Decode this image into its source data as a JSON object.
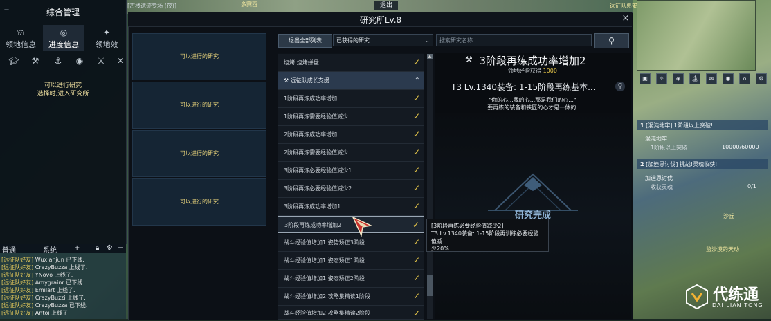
{
  "top_bar": {
    "left_text": "[古楼遗迹专场 (夜)]",
    "exit_label": "退出",
    "location_label": "多赛西",
    "right_text": "远征队惠安"
  },
  "left_panel": {
    "title": "综合管理",
    "tabs": [
      {
        "label": "领地信息",
        "icon": "territory-icon"
      },
      {
        "label": "进度信息",
        "icon": "progress-icon",
        "active": true
      },
      {
        "label": "领地效",
        "icon": "effect-icon"
      }
    ],
    "icon_row": [
      "graduation-cap-icon",
      "tools-icon",
      "anchor-icon",
      "cauldron-icon",
      "crossed-swords-icon",
      "close-icon"
    ],
    "message_line1": "可以进行研究",
    "message_line2": "选择时,进入研究所"
  },
  "chat": {
    "tabs": [
      "普通",
      "系统"
    ],
    "lines": [
      {
        "channel": "[远征队好友]",
        "text": "Wuxianjun 已下线."
      },
      {
        "channel": "[远征队好友]",
        "text": "CrazyBuzza 上线了."
      },
      {
        "channel": "[远征队好友]",
        "text": "YNovo 上线了."
      },
      {
        "channel": "[远征队好友]",
        "text": "Amygrainr 已下线."
      },
      {
        "channel": "[远征队好友]",
        "text": "Emilart 上线了."
      },
      {
        "channel": "[远征队好友]",
        "text": "CrazyBuzzi 上线了."
      },
      {
        "channel": "[远征队好友]",
        "text": "CrazyBuzza 已下线."
      },
      {
        "channel": "[远征队好友]",
        "text": "Antoi 上线了."
      }
    ]
  },
  "window": {
    "title": "研究所Lv.8",
    "close_label": "×"
  },
  "slots": [
    {
      "label": "可以进行的研究"
    },
    {
      "label": "可以进行的研究"
    },
    {
      "label": "可以进行的研究"
    },
    {
      "label": "可以进行的研究"
    }
  ],
  "toolbar": {
    "return_label": "退出全部列表",
    "filter_value": "已获得的研究",
    "search_placeholder": "搜索研究名称"
  },
  "list": {
    "rows": [
      {
        "label": "烧烤:烧烤拼盘",
        "done": true
      },
      {
        "label": "远征队成长支援",
        "header": true
      },
      {
        "label": "1阶段再炼成功率增加",
        "done": true
      },
      {
        "label": "1阶段再炼需要经验值减少",
        "done": true
      },
      {
        "label": "2阶段再炼成功率增加",
        "done": true
      },
      {
        "label": "2阶段再炼需要经验值减少",
        "done": true
      },
      {
        "label": "3阶段再炼必要经验值减少1",
        "done": true
      },
      {
        "label": "3阶段再炼必要经验值减少2",
        "done": true
      },
      {
        "label": "3阶段再炼成功率增加1",
        "done": true
      },
      {
        "label": "3阶段再炼成功率增加2",
        "done": true,
        "selected": true
      },
      {
        "label": "战斗经验值增加1:姿势矫正3阶段",
        "done": true
      },
      {
        "label": "战斗经验值增加1:姿态矫正1阶段",
        "done": true
      },
      {
        "label": "战斗经验值增加1:姿态矫正2阶段",
        "done": true
      },
      {
        "label": "战斗经验值增加2:攻略集精读1阶段",
        "done": true
      },
      {
        "label": "战斗经验值增加2:攻略集精读2阶段",
        "done": true
      }
    ]
  },
  "detail": {
    "title": "3阶段再练成功率增加2",
    "exp_label": "领地经验获得",
    "exp_value": "1000",
    "subtitle": "T3 Lv.1340装备: 1-15阶段再练基本...",
    "quote1": "\"你的心...我的心...那是我们的心...\"",
    "quote2": "要再练的装备和铁匠的心才是一体的.",
    "complete_text": "研究完成"
  },
  "tooltip": {
    "line1": "[3阶段再练必要经验值减少2]",
    "line2": "T3 Lv.1340装备: 1-15阶段再训练必要经验值减",
    "line3": "少20%"
  },
  "quests": [
    {
      "num": "1",
      "title": "[混沌地牢] 1阶段以上突破!",
      "sub": "混沌地牢",
      "detail": "1阶段以上突破",
      "progress": "10000/60000"
    },
    {
      "num": "2",
      "title": "[加迪恩讨伐] 挑战!灵魂收获!",
      "sub": "加迪恩讨伐",
      "detail": "收获灵魂",
      "progress": "0/1"
    }
  ],
  "map_labels": {
    "label1": "沙丘",
    "label2": "监沙漠的天动"
  },
  "logo": {
    "main": "代练通",
    "sub": "DAI LIAN TONG"
  }
}
